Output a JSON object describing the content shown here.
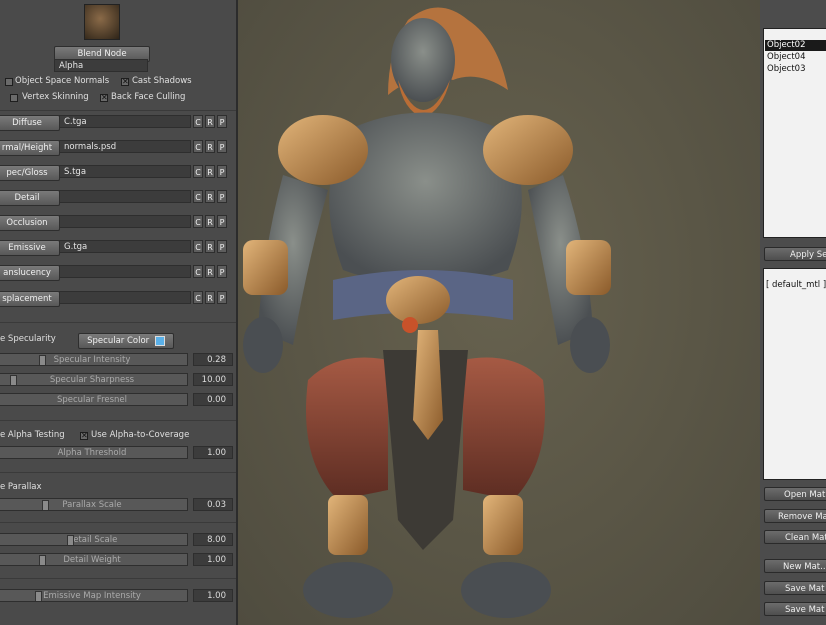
{
  "blend": {
    "button": "Blend Node",
    "mode": "Alpha"
  },
  "options": {
    "object_space_normals": {
      "label": "Object Space Normals",
      "checked": false
    },
    "cast_shadows": {
      "label": "Cast Shadows",
      "checked": true
    },
    "vertex_skinning": {
      "label": "Vertex Skinning",
      "checked": false
    },
    "back_face_culling": {
      "label": "Back Face Culling",
      "checked": true
    }
  },
  "maps": [
    {
      "label": "Diffuse",
      "file": "C.tga"
    },
    {
      "label": "rmal/Height",
      "file": "normals.psd"
    },
    {
      "label": "pec/Gloss",
      "file": "S.tga"
    },
    {
      "label": "Detail",
      "file": ""
    },
    {
      "label": "Occlusion",
      "file": ""
    },
    {
      "label": "Emissive",
      "file": "G.tga"
    },
    {
      "label": "anslucency",
      "file": ""
    },
    {
      "label": "splacement",
      "file": ""
    }
  ],
  "map_buttons": [
    "C",
    "R",
    "P"
  ],
  "specularity": {
    "label": "e Specularity",
    "color_button": "Specular Color",
    "color": "#5ab0e8",
    "intensity": {
      "label": "Specular Intensity",
      "value": "0.28"
    },
    "sharpness": {
      "label": "Specular Sharpness",
      "value": "10.00"
    },
    "fresnel": {
      "label": "Specular Fresnel",
      "value": "0.00"
    }
  },
  "alpha": {
    "testing_label": "e Alpha Testing",
    "coverage": {
      "label": "Use Alpha-to-Coverage",
      "checked": true
    },
    "threshold": {
      "label": "Alpha Threshold",
      "value": "1.00"
    }
  },
  "parallax": {
    "label": "e Parallax",
    "scale": {
      "label": "Parallax Scale",
      "value": "0.03"
    }
  },
  "detail": {
    "scale": {
      "label": "Detail Scale",
      "value": "8.00"
    },
    "weight": {
      "label": "Detail Weight",
      "value": "1.00"
    }
  },
  "emissive": {
    "label": "Emissive Map Intensity",
    "value": "1.00"
  },
  "objects": {
    "items": [
      "Object02",
      "Object04",
      "Object03"
    ],
    "selected": "Object02",
    "apply_button": "Apply Se"
  },
  "materials": {
    "items": [
      "[ default_mtl ]"
    ],
    "buttons": [
      "Open Mat",
      "Remove Mat",
      "Clean Mat",
      "New Mat...",
      "Save Mat",
      "Save Mat"
    ]
  },
  "colors": {
    "viewport_bg": "#5a5646",
    "panel_bg": "#4a4a4a",
    "selection": "#1a1a1a"
  }
}
